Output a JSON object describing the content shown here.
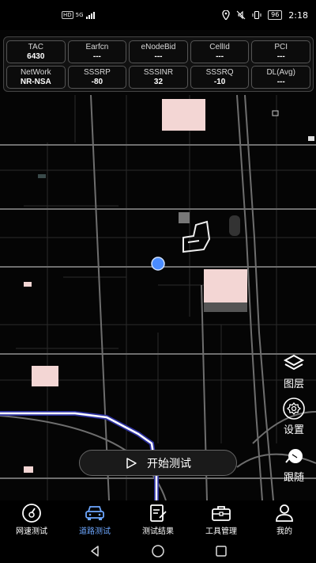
{
  "status_bar": {
    "network_label": "HD",
    "signal_label": "5G",
    "battery": "96",
    "time": "2:18"
  },
  "info_panel": {
    "cells": [
      {
        "label": "TAC",
        "value": "6430"
      },
      {
        "label": "Earfcn",
        "value": "---"
      },
      {
        "label": "eNodeBid",
        "value": "---"
      },
      {
        "label": "CellId",
        "value": "---"
      },
      {
        "label": "PCI",
        "value": "---"
      },
      {
        "label": "NetWork",
        "value": "NR-NSA"
      },
      {
        "label": "SSSRP",
        "value": "-80"
      },
      {
        "label": "SSSINR",
        "value": "32"
      },
      {
        "label": "SSSRQ",
        "value": "-10"
      },
      {
        "label": "DL(Avg)",
        "value": "---"
      }
    ]
  },
  "map_controls": {
    "layers_label": "图层",
    "settings_label": "设置",
    "follow_label": "跟随"
  },
  "start_button": {
    "label": "开始测试"
  },
  "tabs": [
    {
      "label": "网速测试",
      "icon": "speedometer-icon"
    },
    {
      "label": "道路测试",
      "icon": "car-icon",
      "active": true
    },
    {
      "label": "测试结果",
      "icon": "result-doc-icon"
    },
    {
      "label": "工具管理",
      "icon": "toolbox-icon"
    },
    {
      "label": "我的",
      "icon": "user-icon"
    }
  ],
  "colors": {
    "accent": "#6da7ff",
    "route": "#ffffff",
    "route_outline": "#2b2f9e",
    "building": "#f3d6d4"
  }
}
